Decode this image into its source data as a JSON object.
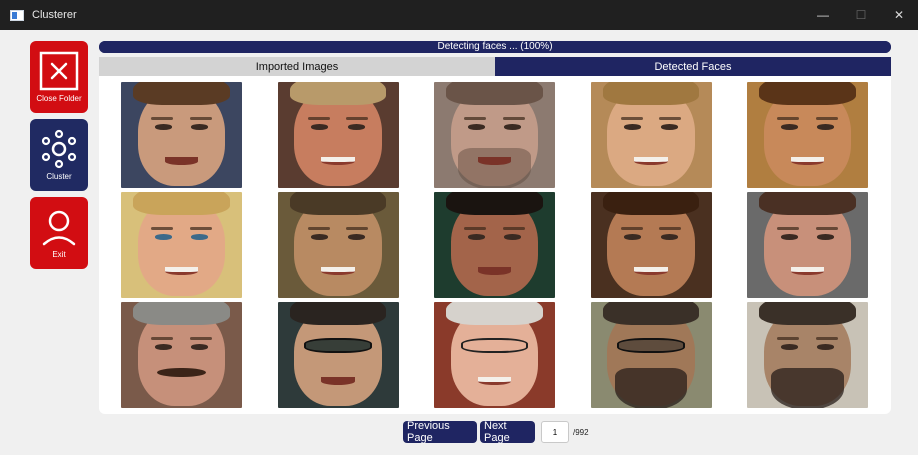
{
  "window": {
    "title": "Clusterer",
    "controls": {
      "minimize": "—",
      "maximize": "☐",
      "close": "✕"
    }
  },
  "sidebar": {
    "items": [
      {
        "label": "Close Folder",
        "icon": "close-box-icon",
        "color": "#d20d12"
      },
      {
        "label": "Cluster",
        "icon": "cluster-icon",
        "color": "#202a62"
      },
      {
        "label": "Exit",
        "icon": "user-icon",
        "color": "#d20d12"
      }
    ]
  },
  "progress": {
    "text": "Detecting faces ... (100%)",
    "value": 100
  },
  "tabs": [
    {
      "label": "Imported Images",
      "active": false
    },
    {
      "label": "Detected Faces",
      "active": true
    }
  ],
  "pager": {
    "prev_label": "Previous Page",
    "next_label": "Next Page",
    "current_page": "1",
    "total": "/992"
  },
  "colors": {
    "navy": "#1f2562",
    "red": "#d20d12",
    "tab_inactive": "#d3d3d3"
  }
}
